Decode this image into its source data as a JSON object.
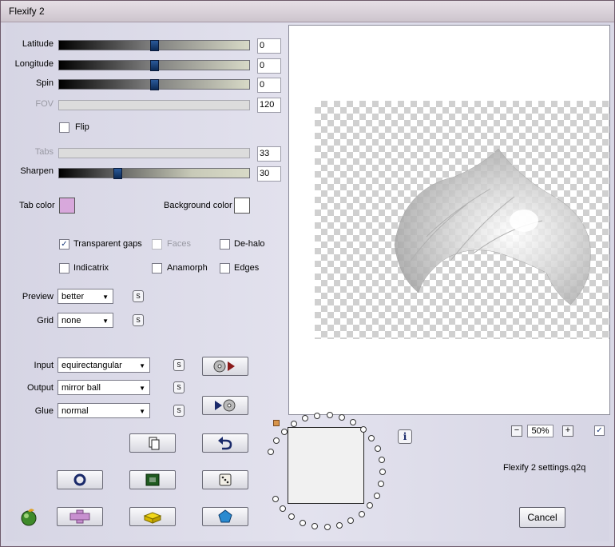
{
  "window": {
    "title": "Flexify 2"
  },
  "sliders": [
    {
      "label": "Latitude",
      "value": "0",
      "enabled": true,
      "level": 0.5
    },
    {
      "label": "Longitude",
      "value": "0",
      "enabled": true,
      "level": 0.5
    },
    {
      "label": "Spin",
      "value": "0",
      "enabled": true,
      "level": 0.5
    },
    {
      "label": "FOV",
      "value": "120",
      "enabled": false
    },
    {
      "label": "Tabs",
      "value": "33",
      "enabled": false
    },
    {
      "label": "Sharpen",
      "value": "30",
      "enabled": true,
      "level": 0.3
    }
  ],
  "flip": {
    "label": "Flip",
    "checked": false
  },
  "colors": {
    "tab_label": "Tab color",
    "tab_value": "#d8a8dc",
    "bg_label": "Background color",
    "bg_value": "#ffffff"
  },
  "options": {
    "transparent_gaps": {
      "label": "Transparent gaps",
      "checked": true
    },
    "faces": {
      "label": "Faces",
      "checked": false,
      "enabled": false
    },
    "de_halo": {
      "label": "De-halo",
      "checked": false
    },
    "indicatrix": {
      "label": "Indicatrix",
      "checked": false
    },
    "anamorph": {
      "label": "Anamorph",
      "checked": false
    },
    "edges": {
      "label": "Edges",
      "checked": false
    }
  },
  "dropdowns": {
    "preview": {
      "label": "Preview",
      "value": "better"
    },
    "grid": {
      "label": "Grid",
      "value": "none"
    },
    "input": {
      "label": "Input",
      "value": "equirectangular"
    },
    "output": {
      "label": "Output",
      "value": "mirror ball"
    },
    "glue": {
      "label": "Glue",
      "value": "normal"
    }
  },
  "s_button_label": "S",
  "zoom": {
    "value": "50%",
    "minus": "−",
    "plus": "+"
  },
  "settings_file": "Flexify 2 settings.q2q",
  "cancel_label": "Cancel",
  "info_label": "i",
  "checkmark": "✓"
}
